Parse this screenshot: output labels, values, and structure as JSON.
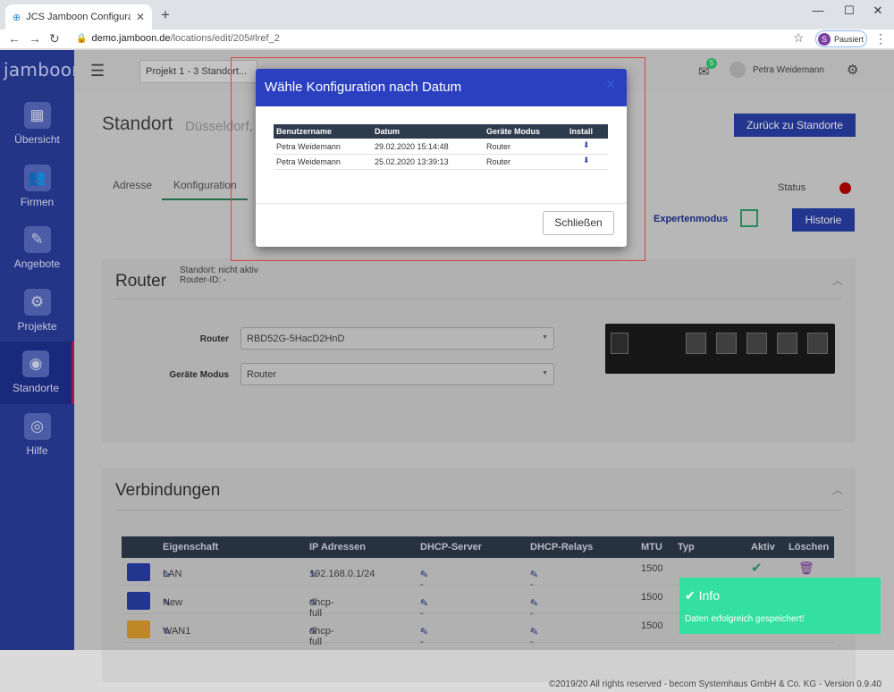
{
  "browser": {
    "tab_title": "JCS Jamboon Configuration Serv",
    "url_host": "demo.jamboon.de",
    "url_path": "/locations/edit/205#lref_2",
    "profile_initial": "S",
    "profile_status": "Pausiert"
  },
  "app": {
    "logo": "jamboon",
    "project_select": "Projekt 1 - 3 Standort...",
    "notification_count": "5",
    "user_name": "Petra Weidemann"
  },
  "sidebar": {
    "items": [
      {
        "label": "Übersicht",
        "icon": "dashboard-icon"
      },
      {
        "label": "Firmen",
        "icon": "people-icon"
      },
      {
        "label": "Angebote",
        "icon": "document-icon"
      },
      {
        "label": "Projekte",
        "icon": "gears-icon"
      },
      {
        "label": "Standorte",
        "icon": "globe-pin-icon"
      },
      {
        "label": "Hilfe",
        "icon": "lifebuoy-icon"
      }
    ]
  },
  "page": {
    "title": "Standort",
    "subtitle": "Düsseldorf,",
    "back_button": "Zurück zu Standorte",
    "tabs": [
      "Adresse",
      "Konfiguration"
    ],
    "status_label": "Status",
    "expert_mode_label": "Expertenmodus",
    "history_button": "Historie"
  },
  "router_card": {
    "title": "Router",
    "status_line": "Standort: nicht aktiv",
    "router_id_line": "Router-ID: -",
    "router_label": "Router",
    "router_value": "RBD52G-5HacD2HnD",
    "mode_label": "Geräte Modus",
    "mode_value": "Router"
  },
  "connections": {
    "title": "Verbindungen",
    "headers": [
      "Eigenschaft",
      "IP Adressen",
      "DHCP-Server",
      "DHCP-Relays",
      "MTU",
      "Typ",
      "Aktiv",
      "Löschen"
    ],
    "rows": [
      {
        "name": "LAN",
        "ip": "192.168.0.1/24",
        "dhcp_server": "--",
        "dhcp_relays": "--",
        "mtu": "1500"
      },
      {
        "name": "New",
        "ip": "dhcp-full",
        "dhcp_server": "--",
        "dhcp_relays": "--",
        "mtu": "1500"
      },
      {
        "name": "WAN1",
        "ip": "dhcp-full",
        "dhcp_server": "--",
        "dhcp_relays": "--",
        "mtu": "1500"
      }
    ]
  },
  "modal": {
    "title": "Wähle Konfiguration nach Datum",
    "headers": [
      "Benutzername",
      "Datum",
      "Geräte Modus",
      "Install"
    ],
    "rows": [
      {
        "user": "Petra Weidemann",
        "date": "29.02.2020 15:14:48",
        "mode": "Router"
      },
      {
        "user": "Petra Weidemann",
        "date": "25.02.2020 13:39:13",
        "mode": "Router"
      }
    ],
    "close_button": "Schließen"
  },
  "toast": {
    "title": "Info",
    "message": "Daten erfolgreich gespeichert!"
  },
  "footer": "©2019/20 All rights reserved - becom Systemhaus GmbH & Co. KG - Version 0.9.40",
  "colors": {
    "primary": "#2a40a8",
    "sidebar": "#2b3fa0",
    "success": "#34e0a1",
    "status_red": "#bb0000"
  }
}
